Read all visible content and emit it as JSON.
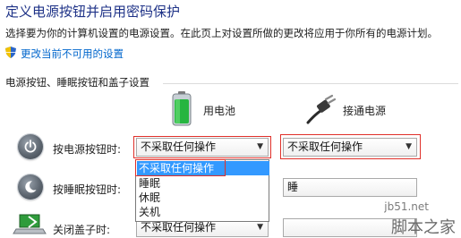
{
  "title": "定义电源按钮并启用密码保护",
  "description": "选择要为你的计算机设置的电源设置。在此页上对设置所做的更改将应用于你所有的电源计划。",
  "change_link": "更改当前不可用的设置",
  "section_title": "电源按钮、睡眠按钮和盖子设置",
  "columns": {
    "battery": "用电池",
    "plugged": "接通电源"
  },
  "rows": {
    "power_button": {
      "label": "按电源按钮时:",
      "battery_value": "不采取任何操作",
      "plugged_value": "不采取任何操作"
    },
    "sleep_button": {
      "label": "按睡眠按钮时:",
      "plugged_value": "睡"
    },
    "lid": {
      "label": "关闭盖子时:",
      "battery_value": "不采取任何操作"
    }
  },
  "dropdown_options": [
    "不采取任何操作",
    "睡眠",
    "休眠",
    "关机"
  ],
  "watermark": {
    "site": "jb51.net",
    "brand": "脚本之家"
  },
  "colors": {
    "title": "#1e3287",
    "link": "#0066cc",
    "highlight": "#3399ff",
    "callout": "#e0302a"
  }
}
